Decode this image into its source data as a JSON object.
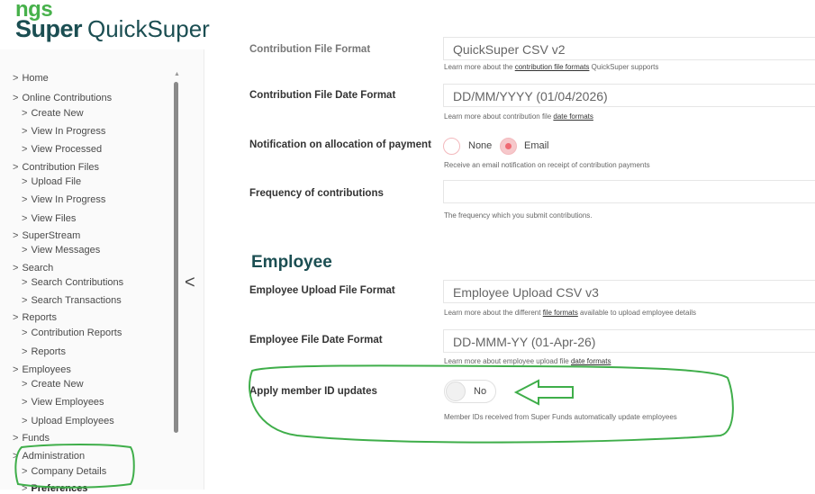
{
  "header": {
    "logo_top": "ngs",
    "logo_bottom": "Super",
    "app_name": "QuickSuper"
  },
  "sidebar": {
    "items": [
      {
        "label": "Home"
      },
      {
        "label": "Online Contributions"
      },
      {
        "label": "Create New"
      },
      {
        "label": "View In Progress"
      },
      {
        "label": "View Processed"
      },
      {
        "label": "Contribution Files"
      },
      {
        "label": "Upload File"
      },
      {
        "label": "View In Progress"
      },
      {
        "label": "View Files"
      },
      {
        "label": "SuperStream"
      },
      {
        "label": "View Messages"
      },
      {
        "label": "Search"
      },
      {
        "label": "Search Contributions"
      },
      {
        "label": "Search Transactions"
      },
      {
        "label": "Reports"
      },
      {
        "label": "Contribution Reports"
      },
      {
        "label": "Reports"
      },
      {
        "label": "Employees"
      },
      {
        "label": "Create New"
      },
      {
        "label": "View Employees"
      },
      {
        "label": "Upload Employees"
      },
      {
        "label": "Funds"
      },
      {
        "label": "Administration"
      },
      {
        "label": "Company Details"
      },
      {
        "label": "Preferences"
      }
    ],
    "chevron": ">",
    "collapse_label": "<"
  },
  "main": {
    "partial_row": {
      "label": "Contribution File Format",
      "value": "QuickSuper CSV v2"
    },
    "file_format_help": {
      "pre": "Learn more about the ",
      "link": "contribution file formats",
      "post": " QuickSuper supports"
    },
    "contrib_date": {
      "label": "Contribution File Date Format",
      "value": "DD/MM/YYYY (01/04/2026)",
      "help_pre": "Learn more about contribution file ",
      "help_link": "date formats"
    },
    "notification": {
      "label": "Notification on allocation of payment",
      "options": [
        "None",
        "Email"
      ],
      "selected": "Email",
      "help": "Receive an email notification on receipt of contribution payments"
    },
    "frequency": {
      "label": "Frequency of contributions",
      "value": "",
      "help": "The frequency which you submit contributions."
    },
    "employee_section": {
      "title": "Employee"
    },
    "employee_upload": {
      "label": "Employee Upload File Format",
      "value": "Employee Upload CSV v3",
      "help_pre": "Learn more about the different ",
      "help_link": "file formats",
      "help_post": " available to upload employee details"
    },
    "employee_date": {
      "label": "Employee File Date Format",
      "value": "DD-MMM-YY (01-Apr-26)",
      "help_pre": "Learn more about employee upload file ",
      "help_link": "date formats"
    },
    "member_id": {
      "label": "Apply member ID updates",
      "toggle_label": "No",
      "toggle_on": false,
      "help": "Member IDs received from Super Funds automatically update employees"
    }
  },
  "colors": {
    "brand_green": "#47b14b",
    "brand_dark": "#1b4e52",
    "radio_accent": "#ef6a73",
    "annotation_green": "#3fae4a"
  }
}
